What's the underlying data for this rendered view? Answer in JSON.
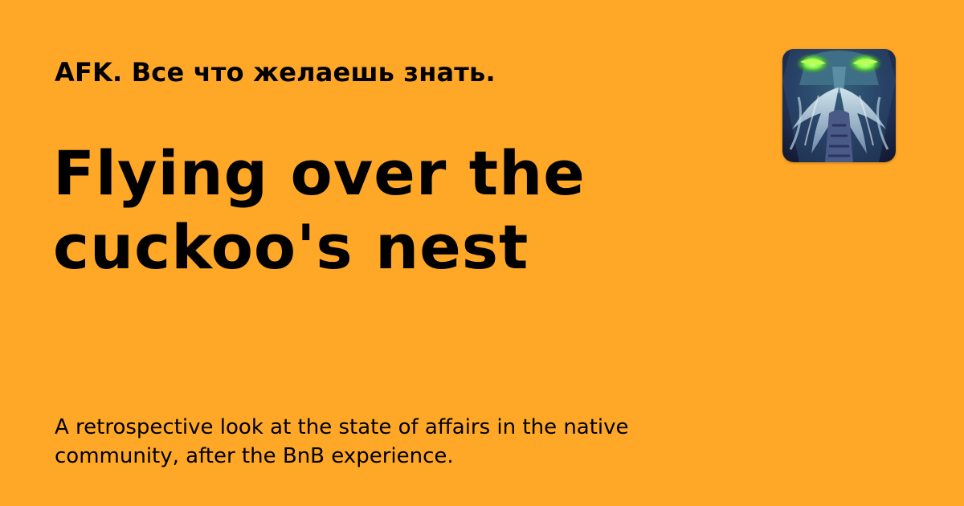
{
  "card": {
    "publication_name": "AFK. Все что желаешь знать.",
    "title": "Flying over the cuckoo's nest",
    "subtitle": "A retrospective look at the state of affairs in the native community, after the BnB experience.",
    "logo": {
      "icon": "publication-logo-icon",
      "depicts": "stylized bearded warrior face with glowing green eyes"
    }
  },
  "colors": {
    "background": "#FFA726",
    "text": "#000000",
    "logo_eyes": "#7CFC3A",
    "logo_beard": "#A9C3D6",
    "logo_dark": "#1E2746"
  }
}
